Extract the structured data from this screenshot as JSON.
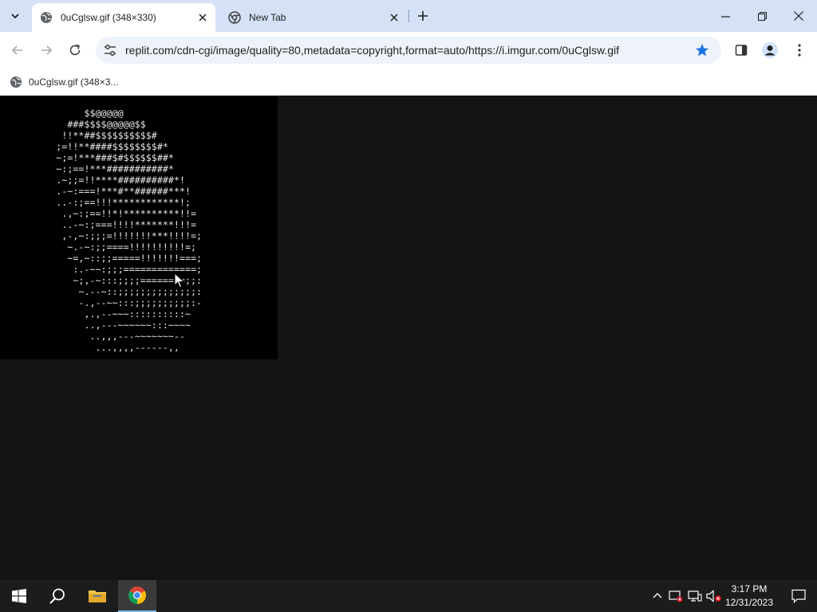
{
  "browser": {
    "tabs": [
      {
        "title": "0uCglsw.gif (348×330)",
        "active": true,
        "favicon": "globe-icon"
      },
      {
        "title": "New Tab",
        "active": false,
        "favicon": "chrome-icon"
      }
    ],
    "address_bar": {
      "url": "replit.com/cdn-cgi/image/quality=80,metadata=copyright,format=auto/https://i.imgur.com/0uCglsw.gif",
      "site_info_icon": "tune-icon",
      "bookmarked": true
    },
    "bookmarks": [
      {
        "label": "0uCglsw.gif (348×3...",
        "icon": "globe-icon"
      }
    ],
    "accent_color": "#1a73e8"
  },
  "page": {
    "image_background": "#000000",
    "ascii_art": [
      "               $$@@@@@",
      "            ###$$$$@@@@@$$",
      "           !!**##$$$$$$$$$$#",
      "          ;=!!**####$$$$$$$$#*",
      "          ~;=!***###$#$$$$$$##*",
      "          ~:;==!***###########*",
      "          .~;;=!!****##########*!",
      "          .-~:===!***#**######***!",
      "          ..-:;==!!!************!;",
      "           .,~:;==!!*!**********!!=",
      "           ..-~:;===!!!!*******!!!=",
      "           ,-,~:;;;=!!!!!!!***!!!!=;",
      "            ~.-~:;;====!!!!!!!!!!=;",
      "            ~=,~::;;=====!!!!!!!===;",
      "             :.-~~:;;;=============;",
      "             ~;,-~:::;;;;========;;:",
      "              ~.--~::;;;;;;;;;;;;;;:",
      "              -.,--~~:::;;;;;;;;;;:-",
      "               ,.,--~~~::::::::::~",
      "               ..,---~~~~~~:::~~~~",
      "                ..,,,---~~~~~~~--",
      "                 ...,,,,------,,"
    ]
  },
  "taskbar": {
    "apps": [
      {
        "name": "start",
        "icon": "windows-start-icon"
      },
      {
        "name": "search",
        "icon": "search-icon"
      },
      {
        "name": "file-explorer",
        "icon": "folder-icon"
      },
      {
        "name": "chrome",
        "icon": "chrome-icon",
        "active": true
      }
    ],
    "tray": {
      "time": "3:17 PM",
      "date": "12/31/2023"
    }
  }
}
